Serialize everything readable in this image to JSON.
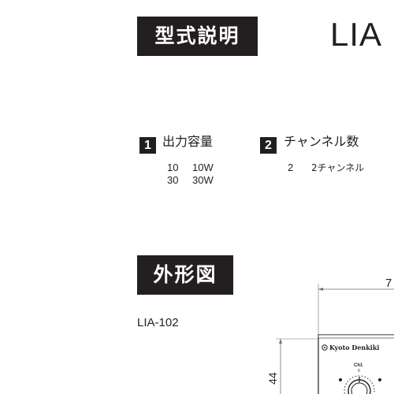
{
  "sections": {
    "model": "型式説明",
    "outline": "外形図"
  },
  "series_title": "LIA",
  "fields": [
    {
      "number": "1",
      "title": "出力容量",
      "options": [
        {
          "code": "10",
          "description": "10W"
        },
        {
          "code": "30",
          "description": "30W"
        }
      ]
    },
    {
      "number": "2",
      "title": "チャンネル数",
      "options": [
        {
          "code": "2",
          "description": "2チャンネル"
        }
      ]
    }
  ],
  "outline": {
    "model_name": "LIA-102",
    "dimension_top_partial": "7",
    "dimension_side": "44",
    "panel_brand": "Kyoto Denkiki",
    "knob_label": "Ch1",
    "knob_scale_zero": "0"
  },
  "colors": {
    "ink": "#231f20",
    "paper": "#ffffff",
    "line": "#6d6e71"
  }
}
